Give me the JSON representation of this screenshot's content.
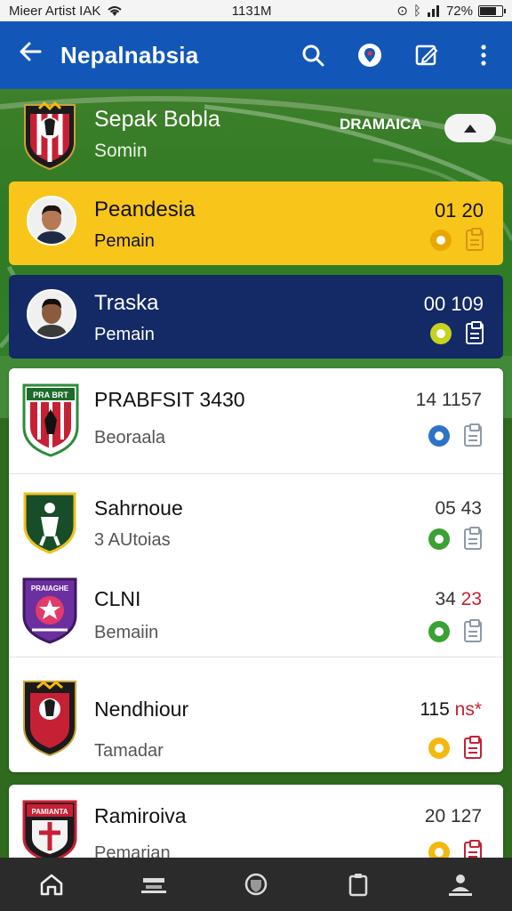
{
  "status_bar": {
    "carrier": "Mieer Artist IAK",
    "time": "1131M",
    "battery": "72%"
  },
  "app_bar": {
    "title": "Nepalnabsia",
    "icons": [
      "back-arrow-icon",
      "search-icon",
      "location-pin-icon",
      "edit-icon",
      "more-vert-icon"
    ]
  },
  "league": {
    "name": "Sepak Bobla",
    "subtitle": "Somin",
    "filter_label": "DRAMAICA"
  },
  "highlighted": [
    {
      "name": "Peandesia",
      "role": "Pemain",
      "score": "01 20",
      "bg": "#f8c61a"
    },
    {
      "name": "Traska",
      "role": "Pemain",
      "score": "00 109",
      "bg": "#132a67"
    }
  ],
  "rows": [
    {
      "name": "PRABFSIT 3430",
      "sub": "Beoraala",
      "score": "14 1157"
    },
    {
      "name": "Sahrnoue",
      "sub": "3 AUtoias",
      "score": "05 43"
    },
    {
      "name": "CLNI",
      "sub": "Bemaiin",
      "score_a": "34",
      "score_b": "23"
    },
    {
      "name": "Nendhiour",
      "sub": "Tamadar",
      "score_a": "115",
      "score_b": "ns*"
    },
    {
      "name": "Ramiroiva",
      "sub": "Pemarian",
      "score": "20 127"
    }
  ],
  "crest_texts": {
    "row1": "PRA BRT",
    "row3": "PRAIAGHE",
    "row5": "PAMIANTA"
  },
  "bottom_nav": [
    "home-icon",
    "list-icon",
    "shield-icon",
    "clipboard-icon",
    "profile-icon"
  ],
  "colors": {
    "app_bar": "#1257b8",
    "status_icon_yellow": "#f2b90f",
    "status_icon_green": "#3aa133",
    "status_icon_blue": "#2d73c8",
    "accent_red": "#c62035"
  }
}
